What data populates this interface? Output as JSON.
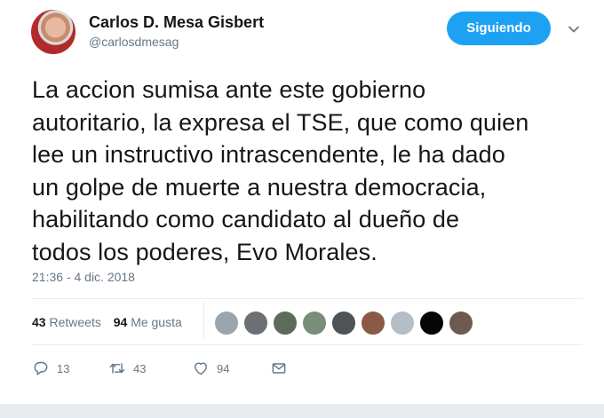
{
  "author": {
    "name": "Carlos D. Mesa Gisbert",
    "handle": "@carlosdmesag"
  },
  "follow_button": {
    "label": "Siguiendo",
    "color": "#1da1f2"
  },
  "tweet": {
    "text": "La accion sumisa ante este gobierno\nautoritario, la expresa el TSE, que como quien\nlee un instructivo intrascendente, le ha dado\nun golpe de muerte a nuestra democracia,\nhabilitando como candidato al dueño de\ntodos los poderes, Evo Morales.",
    "timestamp": "21:36 - 4 dic. 2018"
  },
  "stats": {
    "retweets_count": "43",
    "retweets_label": "Retweets",
    "likes_count": "94",
    "likes_label": "Me gusta"
  },
  "likers": [
    {
      "icon": "default-avatar",
      "color": "#9aa5ae"
    },
    {
      "icon": "user-avatar",
      "color": "#6c6f73"
    },
    {
      "icon": "user-avatar",
      "color": "#5d6b5a"
    },
    {
      "icon": "user-avatar",
      "color": "#7a8d78"
    },
    {
      "icon": "user-avatar",
      "color": "#4f5356"
    },
    {
      "icon": "user-avatar",
      "color": "#8a5a45"
    },
    {
      "icon": "default-avatar",
      "color": "#b5bec6"
    },
    {
      "icon": "user-avatar",
      "color": "#050505"
    },
    {
      "icon": "user-avatar",
      "color": "#6e5a50"
    }
  ],
  "actions": {
    "replies": "13",
    "retweets": "43",
    "likes": "94"
  }
}
